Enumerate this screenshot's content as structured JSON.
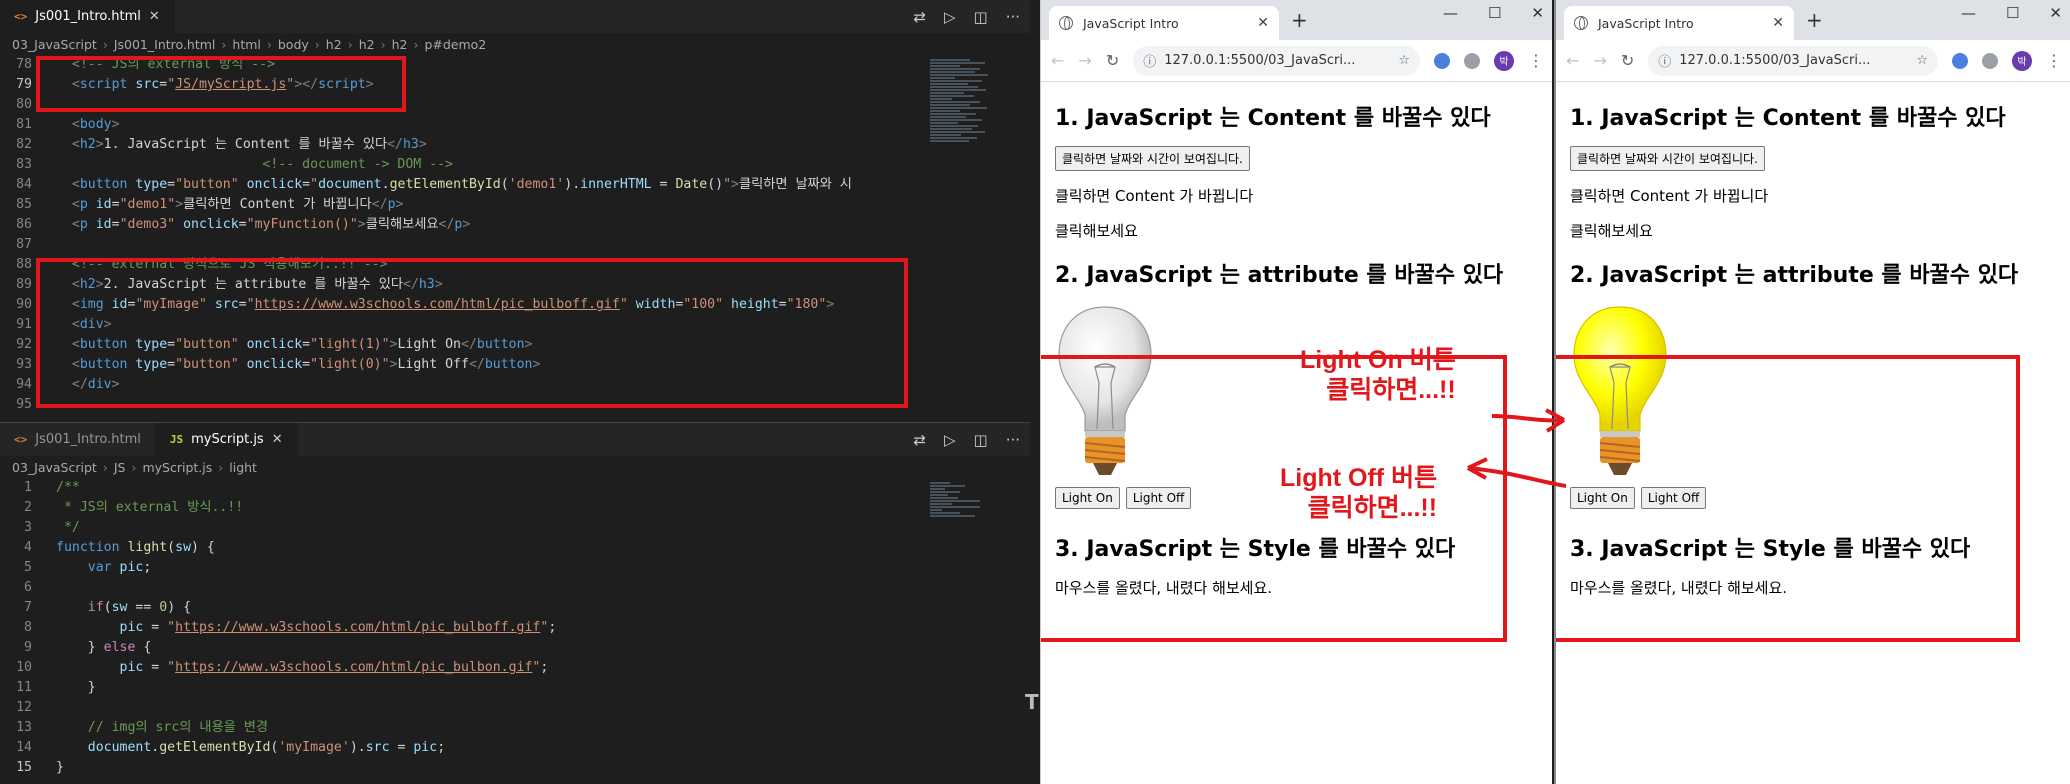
{
  "editor": {
    "top_tabs": [
      {
        "icon": "<>",
        "name": "Js001_Intro.html"
      }
    ],
    "top_breadcrumb": [
      "03_JavaScript",
      "Js001_Intro.html",
      "html",
      "body",
      "h2",
      "h2",
      "h2",
      "p#demo2"
    ],
    "html_lines": [
      {
        "n": "78",
        "parts": [
          [
            "c-com",
            "  <!-- JS의 external 방식 -->"
          ]
        ]
      },
      {
        "n": "79",
        "parts": [
          [
            "c-br",
            "  <"
          ],
          [
            "c-tag",
            "script "
          ],
          [
            "c-attr",
            "src"
          ],
          [
            "c-txt",
            "="
          ],
          [
            "c-str",
            "\""
          ],
          [
            "c-str u",
            "JS/myScript.js"
          ],
          [
            "c-str",
            "\""
          ],
          [
            "c-br",
            "></"
          ],
          [
            "c-tag",
            "script"
          ],
          [
            "c-br",
            ">"
          ]
        ]
      },
      {
        "n": "80",
        "parts": []
      },
      {
        "n": "81",
        "parts": [
          [
            "c-br",
            "  <"
          ],
          [
            "c-tag",
            "body"
          ],
          [
            "c-br",
            ">"
          ]
        ]
      },
      {
        "n": "82",
        "parts": [
          [
            "c-br",
            "  <"
          ],
          [
            "c-tag",
            "h2"
          ],
          [
            "c-br",
            ">"
          ],
          [
            "c-txt",
            "1. JavaScript 는 Content 를 바꿀수 있다"
          ],
          [
            "c-br",
            "</"
          ],
          [
            "c-tag",
            "h3"
          ],
          [
            "c-br",
            ">"
          ]
        ]
      },
      {
        "n": "83",
        "parts": [
          [
            "c-com",
            "                          <!-- document -> DOM -->"
          ]
        ]
      },
      {
        "n": "84",
        "parts": [
          [
            "c-br",
            "  <"
          ],
          [
            "c-tag",
            "button "
          ],
          [
            "c-attr",
            "type"
          ],
          [
            "c-txt",
            "="
          ],
          [
            "c-str",
            "\"button\" "
          ],
          [
            "c-attr",
            "onclick"
          ],
          [
            "c-txt",
            "="
          ],
          [
            "c-str",
            "\""
          ],
          [
            "c-var",
            "document"
          ],
          [
            "c-txt",
            "."
          ],
          [
            "c-fn",
            "getElementById"
          ],
          [
            "c-txt",
            "("
          ],
          [
            "c-str",
            "'demo1'"
          ],
          [
            "c-txt",
            ")."
          ],
          [
            "c-var",
            "innerHTML"
          ],
          [
            "c-txt",
            " = "
          ],
          [
            "c-fn",
            "Date"
          ],
          [
            "c-txt",
            "()"
          ],
          [
            "c-str",
            "\""
          ],
          [
            "c-br",
            ">"
          ],
          [
            "c-txt",
            "클릭하면 날짜와 시"
          ]
        ]
      },
      {
        "n": "85",
        "parts": [
          [
            "c-br",
            "  <"
          ],
          [
            "c-tag",
            "p "
          ],
          [
            "c-attr",
            "id"
          ],
          [
            "c-txt",
            "="
          ],
          [
            "c-str",
            "\"demo1\""
          ],
          [
            "c-br",
            ">"
          ],
          [
            "c-txt",
            "클릭하면 Content 가 바뀝니다"
          ],
          [
            "c-br",
            "</"
          ],
          [
            "c-tag",
            "p"
          ],
          [
            "c-br",
            ">"
          ]
        ]
      },
      {
        "n": "86",
        "parts": [
          [
            "c-br",
            "  <"
          ],
          [
            "c-tag",
            "p "
          ],
          [
            "c-attr",
            "id"
          ],
          [
            "c-txt",
            "="
          ],
          [
            "c-str",
            "\"demo3\" "
          ],
          [
            "c-attr",
            "onclick"
          ],
          [
            "c-txt",
            "="
          ],
          [
            "c-str",
            "\"myFunction()\""
          ],
          [
            "c-br",
            ">"
          ],
          [
            "c-txt",
            "클릭해보세요"
          ],
          [
            "c-br",
            "</"
          ],
          [
            "c-tag",
            "p"
          ],
          [
            "c-br",
            ">"
          ]
        ]
      },
      {
        "n": "87",
        "parts": []
      },
      {
        "n": "88",
        "parts": [
          [
            "c-com",
            "  <!-- external 방식으로 JS 적용해보기..!! -->"
          ]
        ]
      },
      {
        "n": "89",
        "parts": [
          [
            "c-br",
            "  <"
          ],
          [
            "c-tag",
            "h2"
          ],
          [
            "c-br",
            ">"
          ],
          [
            "c-txt",
            "2. JavaScript 는 attribute 를 바꿀수 있다"
          ],
          [
            "c-br",
            "</"
          ],
          [
            "c-tag",
            "h3"
          ],
          [
            "c-br",
            ">"
          ]
        ]
      },
      {
        "n": "90",
        "parts": [
          [
            "c-br",
            "  <"
          ],
          [
            "c-tag",
            "img "
          ],
          [
            "c-attr",
            "id"
          ],
          [
            "c-txt",
            "="
          ],
          [
            "c-str",
            "\"myImage\" "
          ],
          [
            "c-attr",
            "src"
          ],
          [
            "c-txt",
            "="
          ],
          [
            "c-str",
            "\""
          ],
          [
            "c-str u",
            "https://www.w3schools.com/html/pic_bulboff.gif"
          ],
          [
            "c-str",
            "\" "
          ],
          [
            "c-attr",
            "width"
          ],
          [
            "c-txt",
            "="
          ],
          [
            "c-str",
            "\"100\" "
          ],
          [
            "c-attr",
            "height"
          ],
          [
            "c-txt",
            "="
          ],
          [
            "c-str",
            "\"180\""
          ],
          [
            "c-br",
            ">"
          ]
        ]
      },
      {
        "n": "91",
        "parts": [
          [
            "c-br",
            "  <"
          ],
          [
            "c-tag",
            "div"
          ],
          [
            "c-br",
            ">"
          ]
        ]
      },
      {
        "n": "92",
        "parts": [
          [
            "c-br",
            "  <"
          ],
          [
            "c-tag",
            "button "
          ],
          [
            "c-attr",
            "type"
          ],
          [
            "c-txt",
            "="
          ],
          [
            "c-str",
            "\"button\" "
          ],
          [
            "c-attr",
            "onclick"
          ],
          [
            "c-txt",
            "="
          ],
          [
            "c-str",
            "\"light(1)\""
          ],
          [
            "c-br",
            ">"
          ],
          [
            "c-txt",
            "Light On"
          ],
          [
            "c-br",
            "</"
          ],
          [
            "c-tag",
            "button"
          ],
          [
            "c-br",
            ">"
          ]
        ]
      },
      {
        "n": "93",
        "parts": [
          [
            "c-br",
            "  <"
          ],
          [
            "c-tag",
            "button "
          ],
          [
            "c-attr",
            "type"
          ],
          [
            "c-txt",
            "="
          ],
          [
            "c-str",
            "\"button\" "
          ],
          [
            "c-attr",
            "onclick"
          ],
          [
            "c-txt",
            "="
          ],
          [
            "c-str",
            "\"light(0)\""
          ],
          [
            "c-br",
            ">"
          ],
          [
            "c-txt",
            "Light Off"
          ],
          [
            "c-br",
            "</"
          ],
          [
            "c-tag",
            "button"
          ],
          [
            "c-br",
            ">"
          ]
        ]
      },
      {
        "n": "94",
        "parts": [
          [
            "c-br",
            "  </"
          ],
          [
            "c-tag",
            "div"
          ],
          [
            "c-br",
            ">"
          ]
        ]
      },
      {
        "n": "95",
        "parts": []
      }
    ],
    "bottom_tabs": [
      {
        "icon": "<>",
        "name": "Js001_Intro.html"
      },
      {
        "icon": "JS",
        "name": "myScript.js"
      }
    ],
    "bottom_breadcrumb": [
      "03_JavaScript",
      "JS",
      "myScript.js",
      "light"
    ],
    "js_lines": [
      {
        "n": "1",
        "parts": [
          [
            "c-com",
            "/**"
          ]
        ]
      },
      {
        "n": "2",
        "parts": [
          [
            "c-com",
            " * JS의 external 방식..!!"
          ]
        ]
      },
      {
        "n": "3",
        "parts": [
          [
            "c-com",
            " */"
          ]
        ]
      },
      {
        "n": "4",
        "parts": [
          [
            "c-kw",
            "function "
          ],
          [
            "c-fn",
            "light"
          ],
          [
            "c-txt",
            "("
          ],
          [
            "c-var",
            "sw"
          ],
          [
            "c-txt",
            ") {"
          ]
        ]
      },
      {
        "n": "5",
        "parts": [
          [
            "c-kw",
            "    var "
          ],
          [
            "c-var",
            "pic"
          ],
          [
            "c-txt",
            ";"
          ]
        ]
      },
      {
        "n": "6",
        "parts": []
      },
      {
        "n": "7",
        "parts": [
          [
            "c-ctl",
            "    if"
          ],
          [
            "c-txt",
            "("
          ],
          [
            "c-var",
            "sw"
          ],
          [
            "c-txt",
            " == "
          ],
          [
            "c-num",
            "0"
          ],
          [
            "c-txt",
            ") {"
          ]
        ]
      },
      {
        "n": "8",
        "parts": [
          [
            "c-var",
            "        pic"
          ],
          [
            "c-txt",
            " = "
          ],
          [
            "c-str",
            "\""
          ],
          [
            "c-str u",
            "https://www.w3schools.com/html/pic_bulboff.gif"
          ],
          [
            "c-str",
            "\""
          ],
          [
            "c-txt",
            ";"
          ]
        ]
      },
      {
        "n": "9",
        "parts": [
          [
            "c-txt",
            "    } "
          ],
          [
            "c-ctl",
            "else"
          ],
          [
            "c-txt",
            " {"
          ]
        ]
      },
      {
        "n": "10",
        "parts": [
          [
            "c-var",
            "        pic"
          ],
          [
            "c-txt",
            " = "
          ],
          [
            "c-str",
            "\""
          ],
          [
            "c-str u",
            "https://www.w3schools.com/html/pic_bulbon.gif"
          ],
          [
            "c-str",
            "\""
          ],
          [
            "c-txt",
            ";"
          ]
        ]
      },
      {
        "n": "11",
        "parts": [
          [
            "c-txt",
            "    }"
          ]
        ]
      },
      {
        "n": "12",
        "parts": []
      },
      {
        "n": "13",
        "parts": [
          [
            "c-com",
            "    // img의 src의 내용을 변경"
          ]
        ]
      },
      {
        "n": "14",
        "parts": [
          [
            "c-var",
            "    document"
          ],
          [
            "c-txt",
            "."
          ],
          [
            "c-fn",
            "getElementById"
          ],
          [
            "c-txt",
            "("
          ],
          [
            "c-str",
            "'myImage'"
          ],
          [
            "c-txt",
            ")."
          ],
          [
            "c-var",
            "src"
          ],
          [
            "c-txt",
            " = "
          ],
          [
            "c-var",
            "pic"
          ],
          [
            "c-txt",
            ";"
          ]
        ]
      },
      {
        "n": "15",
        "parts": [
          [
            "c-txt",
            "}"
          ]
        ]
      }
    ],
    "stray_glyph": "T"
  },
  "browsers": [
    {
      "tab_title": "JavaScript Intro",
      "url": "127.0.0.1:5500/03_JavaScri...",
      "avatar": "박",
      "bulb_state": "off"
    },
    {
      "tab_title": "JavaScript Intro",
      "url": "127.0.0.1:5500/03_JavaScri...",
      "avatar": "박",
      "bulb_state": "on"
    }
  ],
  "page": {
    "h1": "1. JavaScript 는 Content 를 바꿀수 있다",
    "date_button": "클릭하면 날짜와 시간이 보여집니다.",
    "demo1": "클릭하면 Content 가 바뀝니다",
    "demo3": "클릭해보세요",
    "h2": "2. JavaScript 는 attribute 를 바꿀수 있다",
    "light_on": "Light On",
    "light_off": "Light Off",
    "h3": "3. JavaScript 는 Style 를 바꿀수 있다",
    "demo2": "마우스를 올렸다, 내렸다 해보세요."
  },
  "annotations": {
    "on_line1": "Light On 버튼",
    "on_line2": "클릭하면...!!",
    "off_line1": "Light Off 버튼",
    "off_line2": "클릭하면...!!",
    "color": "#e2171c"
  }
}
